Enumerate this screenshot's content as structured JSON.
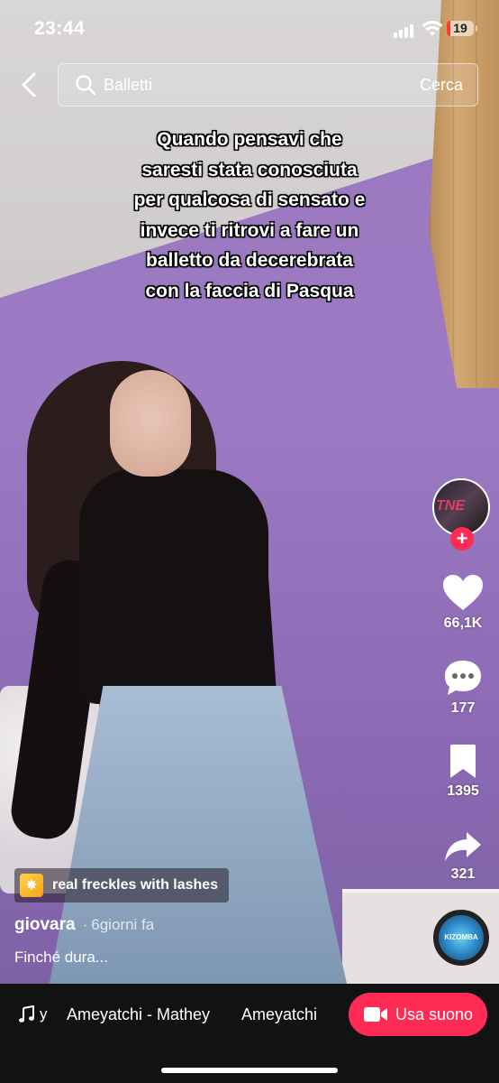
{
  "status_bar": {
    "time": "23:44",
    "battery": "19"
  },
  "search": {
    "query": "Balletti",
    "submit_label": "Cerca"
  },
  "overlay_caption": [
    "Quando pensavi che",
    "saresti stata conosciuta",
    "per qualcosa di sensato e",
    "invece ti ritrovi a fare un",
    "balletto da decerebrata",
    "con la faccia di Pasqua"
  ],
  "avatar": {
    "text": "TNE"
  },
  "actions": {
    "likes": "66,1K",
    "comments": "177",
    "bookmarks": "1395",
    "shares": "321"
  },
  "effect": {
    "label": "real freckles with lashes"
  },
  "author": {
    "name": "giovara",
    "separator": "·",
    "time": "6giorni fa"
  },
  "description": "Finché dura...",
  "music_disc": {
    "text": "KIZOMBA"
  },
  "sound": {
    "prefix": "y",
    "title": "Ameyatchi - Mathey",
    "artist": "Ameyatchi",
    "use_label": "Usa suono"
  },
  "colors": {
    "accent": "#fe2c55",
    "wall": "#9a78c0",
    "bottom_bar": "#121212"
  }
}
